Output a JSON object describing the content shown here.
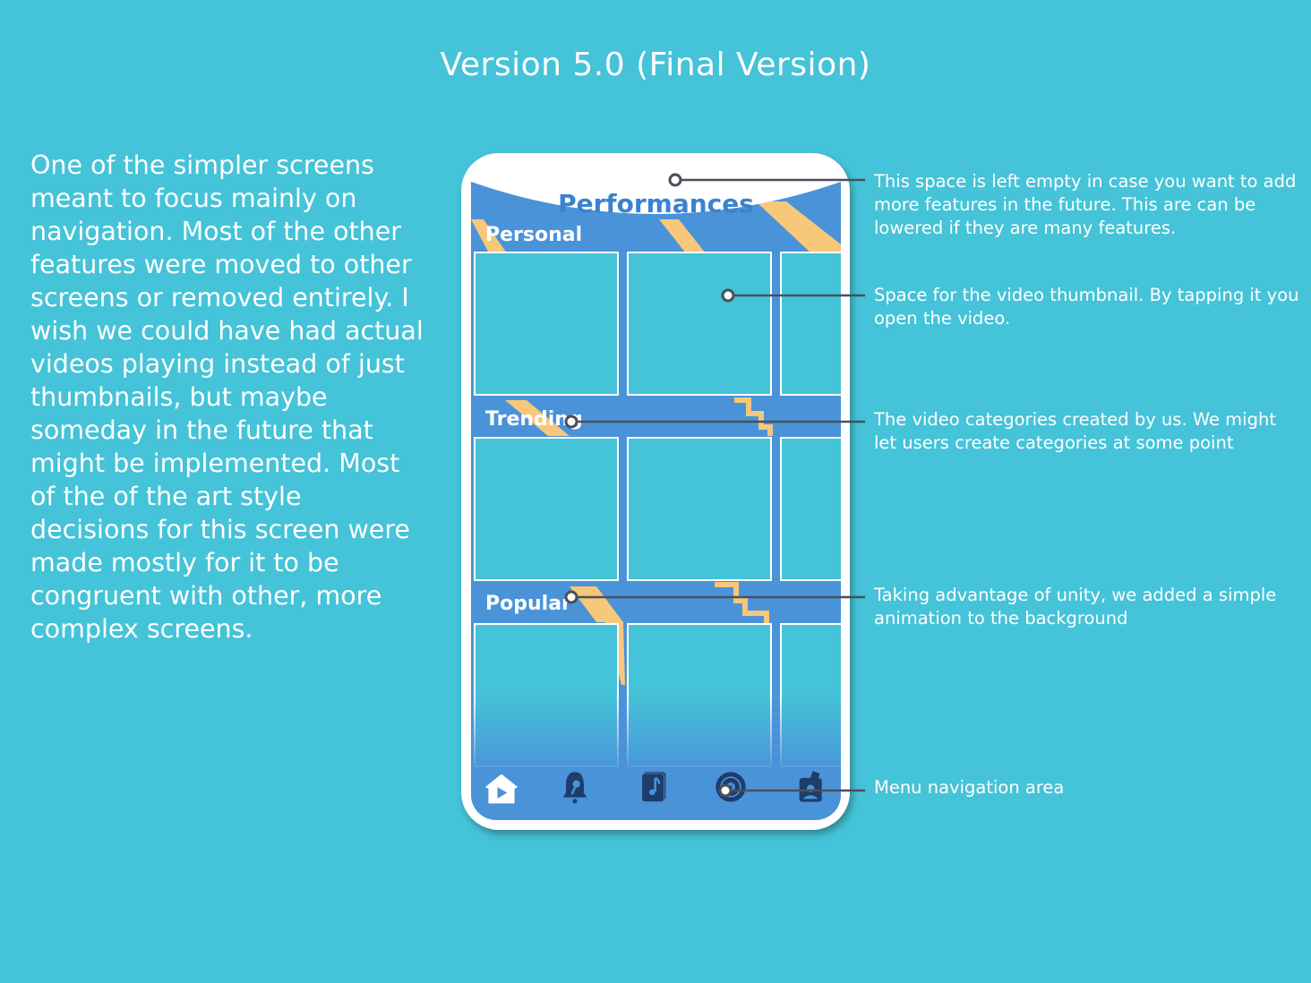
{
  "page": {
    "version_title": "Version 5.0 (Final Version)",
    "description": "One of the simpler screens meant to focus mainly on navigation. Most of the other features were moved to other screens or removed entirely. I wish we could have had actual videos playing instead of just thumbnails, but maybe someday in the future that might be implemented. Most of the of the art style decisions for this screen were made mostly for it to be congruent with other, more complex screens."
  },
  "annotations": {
    "header_space": "This space is left empty in case you want to add more features in the future. This are can be lowered if they are many features.",
    "thumbnail_space": "Space for the video thumbnail. By tapping it you open the video.",
    "categories": "The video categories created by us. We might let users create categories at some point",
    "animation": "Taking advantage of unity, we added a simple animation to the background",
    "menu": "Menu navigation area"
  },
  "app": {
    "title": "Performances",
    "sections": [
      {
        "label": "Personal"
      },
      {
        "label": "Trending"
      },
      {
        "label": "Popular"
      }
    ],
    "nav_icons": [
      "home-play-icon",
      "microphone-bell-icon",
      "music-note-icon",
      "vinyl-record-icon",
      "profile-card-icon"
    ]
  },
  "colors": {
    "background": "#45c3d8",
    "app_blue": "#4a93d8",
    "title_blue": "#3a82cf",
    "stripe_orange": "#f7c77a",
    "icon_navy": "#1e3d6b"
  }
}
